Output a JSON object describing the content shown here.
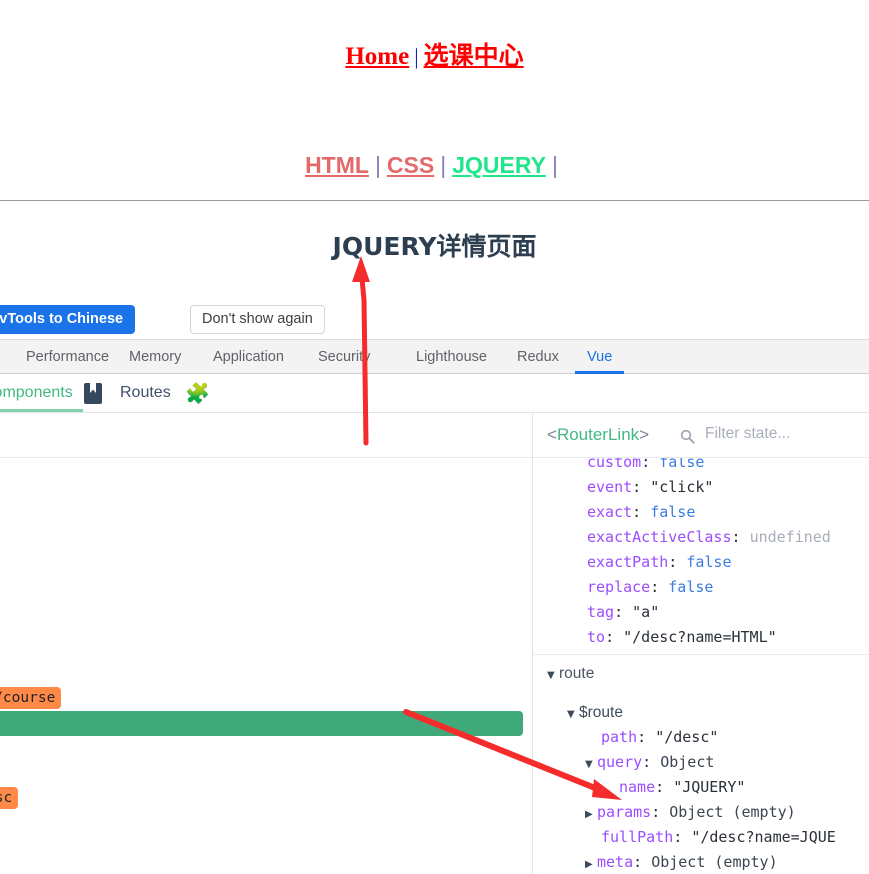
{
  "site": {
    "top_nav": {
      "home": "Home",
      "separator": "|",
      "course_center": "选课中心"
    },
    "sub_nav": {
      "items": [
        {
          "label": "HTML",
          "state": "inactive"
        },
        {
          "label": "CSS",
          "state": "inactive"
        },
        {
          "label": "JQUERY",
          "state": "active"
        }
      ],
      "separator": "|"
    },
    "detail_title": "JQUERY详情页面"
  },
  "devtools": {
    "banner": {
      "switch_language_button": "Switch DevTools to Chinese",
      "dismiss_button": "Don't show again"
    },
    "tabs": [
      {
        "label": "Performance",
        "active": false
      },
      {
        "label": "Memory",
        "active": false
      },
      {
        "label": "Application",
        "active": false
      },
      {
        "label": "Security",
        "active": false
      },
      {
        "label": "Lighthouse",
        "active": false
      },
      {
        "label": "Redux",
        "active": false
      },
      {
        "label": "Vue",
        "active": true
      }
    ],
    "vue_tabs": [
      {
        "label": "Components",
        "active": true
      },
      {
        "label": "Routes",
        "active": false
      }
    ],
    "component_tree": {
      "badges": [
        {
          "text": "w: /course"
        },
        {
          "text": "esc"
        }
      ]
    },
    "state_panel": {
      "component_name_open": "<",
      "component_name": "RouterLink",
      "component_name_close": ">",
      "filter_placeholder": "Filter state...",
      "rows": [
        {
          "indent": 2,
          "caret": "",
          "key": "custom",
          "sep": ": ",
          "value": "false",
          "vtype": "bool"
        },
        {
          "indent": 2,
          "caret": "",
          "key": "event",
          "sep": ": ",
          "value": "\"click\"",
          "vtype": "str"
        },
        {
          "indent": 2,
          "caret": "",
          "key": "exact",
          "sep": ": ",
          "value": "false",
          "vtype": "bool"
        },
        {
          "indent": 2,
          "caret": "",
          "key": "exactActiveClass",
          "sep": ": ",
          "value": "undefined",
          "vtype": "undef"
        },
        {
          "indent": 2,
          "caret": "",
          "key": "exactPath",
          "sep": ": ",
          "value": "false",
          "vtype": "bool"
        },
        {
          "indent": 2,
          "caret": "",
          "key": "replace",
          "sep": ": ",
          "value": "false",
          "vtype": "bool"
        },
        {
          "indent": 2,
          "caret": "",
          "key": "tag",
          "sep": ": ",
          "value": "\"a\"",
          "vtype": "str"
        },
        {
          "indent": 2,
          "caret": "",
          "key": "to",
          "sep": ": ",
          "value": "\"/desc?name=HTML\"",
          "vtype": "str"
        }
      ],
      "route_section": {
        "label": "route",
        "caret": "▼",
        "node": {
          "label": "$route",
          "caret": "▼"
        },
        "rows": [
          {
            "indent": 4,
            "caret": "",
            "key": "path",
            "sep": ": ",
            "value": "\"/desc\"",
            "vtype": "str"
          },
          {
            "indent": 3,
            "caret": "▼",
            "key": "query",
            "sep": ": ",
            "value": "Object",
            "vtype": "obj"
          },
          {
            "indent": 5,
            "caret": "",
            "key": "name",
            "sep": ": ",
            "value": "\"JQUERY\"",
            "vtype": "str"
          },
          {
            "indent": 3,
            "caret": "▶",
            "key": "params",
            "sep": ": ",
            "value": "Object (empty)",
            "vtype": "obj"
          },
          {
            "indent": 4,
            "caret": "",
            "key": "fullPath",
            "sep": ": ",
            "value": "\"/desc?name=JQUE",
            "vtype": "str"
          },
          {
            "indent": 3,
            "caret": "▶",
            "key": "meta",
            "sep": ": ",
            "value": "Object (empty)",
            "vtype": "obj"
          }
        ]
      }
    }
  },
  "annotations": {
    "arrow_vertical": "red-arrow-up-to-page-title",
    "arrow_diagonal": "red-arrow-to-query-name"
  },
  "colors": {
    "link_red": "#ff0000",
    "link_inactive": "#e4696b",
    "link_active_green": "#21e58a",
    "vue_green": "#42b883",
    "selected_row_green": "#3fa97a",
    "badge_orange": "#ff8a48",
    "devtools_blue": "#1a73e8",
    "title_navy": "#2c3e50",
    "annotation_red": "#f22"
  }
}
